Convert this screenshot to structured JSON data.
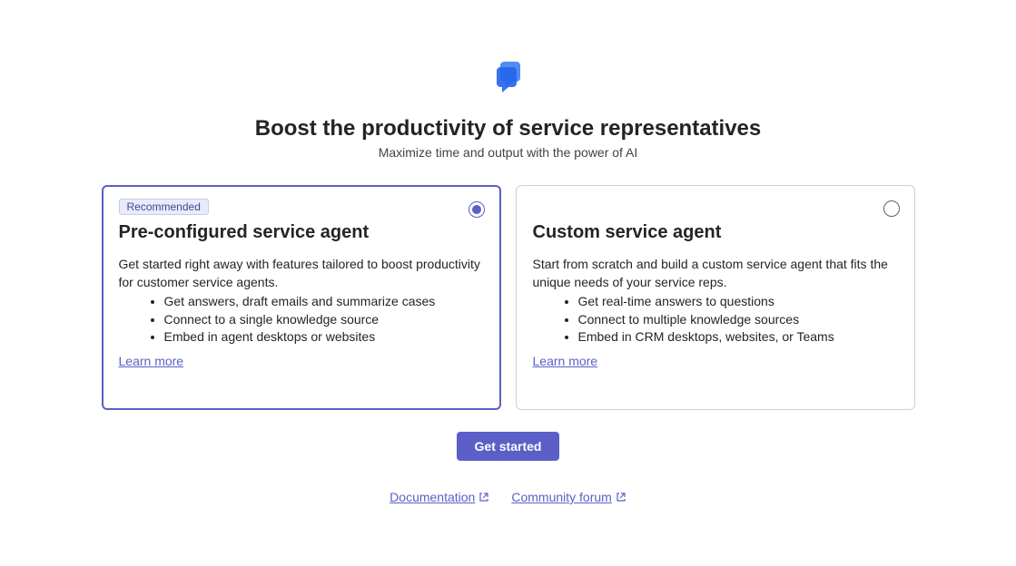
{
  "header": {
    "title": "Boost the productivity of service representatives",
    "subtitle": "Maximize time and output with the power of AI"
  },
  "cards": [
    {
      "badge": "Recommended",
      "title": "Pre-configured service agent",
      "description": "Get started right away with features tailored to boost productivity for customer service agents.",
      "bullets": [
        "Get answers, draft emails and summarize cases",
        "Connect to a single knowledge source",
        "Embed in agent desktops or websites"
      ],
      "learn_more": "Learn more",
      "selected": true
    },
    {
      "title": "Custom service agent",
      "description": "Start from scratch and build a custom service agent that fits the unique needs of your service reps.",
      "bullets": [
        "Get real-time answers to questions",
        "Connect to multiple knowledge sources",
        "Embed in CRM desktops, websites, or Teams"
      ],
      "learn_more": "Learn more",
      "selected": false
    }
  ],
  "cta": {
    "label": "Get started"
  },
  "footer": {
    "documentation": "Documentation",
    "community_forum": "Community forum"
  }
}
